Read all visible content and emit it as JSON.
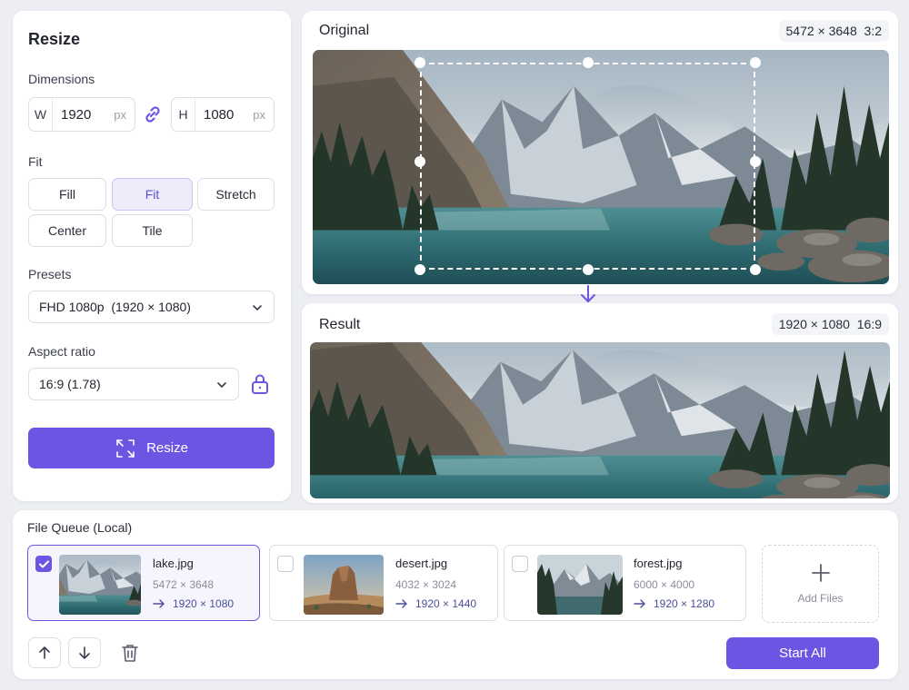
{
  "resize_panel": {
    "title": "Resize",
    "dimensions_label": "Dimensions",
    "width_prefix": "W",
    "width_value": "1920",
    "width_unit": "px",
    "height_prefix": "H",
    "height_value": "1080",
    "height_unit": "px",
    "link_icon": "link-icon",
    "fit_label": "Fit",
    "fit_options": [
      "Fill",
      "Fit",
      "Stretch",
      "Center",
      "Tile"
    ],
    "fit_selected": "Fit",
    "presets_label": "Presets",
    "preset_value": "FHD 1080p  (1920 × 1080)",
    "aspect_label": "Aspect ratio",
    "aspect_value": "16:9 (1.78)",
    "lock_icon": "lock-icon",
    "resize_button": "Resize",
    "resize_icon": "resize-arrows-icon"
  },
  "original": {
    "title": "Original",
    "dims": "5472 × 3648",
    "ratio": "3:2"
  },
  "result": {
    "title": "Result",
    "dims": "1920 × 1080",
    "ratio": "16:9"
  },
  "queue": {
    "title": "File Queue",
    "location": "(Local)",
    "files": [
      {
        "name": "lake.jpg",
        "dims": "5472 × 3648",
        "output": "1920 × 1080",
        "checked": true
      },
      {
        "name": "desert.jpg",
        "dims": "4032 × 3024",
        "output": "1920 × 1440",
        "checked": false
      },
      {
        "name": "forest.jpg",
        "dims": "6000 × 4000",
        "output": "1920 × 1280",
        "checked": false
      }
    ],
    "add_files": "Add Files",
    "start_all": "Start All"
  },
  "colors": {
    "accent": "#6a56e3",
    "accent_soft": "#eeecfb",
    "panel": "#ffffff",
    "background": "#eceef3"
  }
}
